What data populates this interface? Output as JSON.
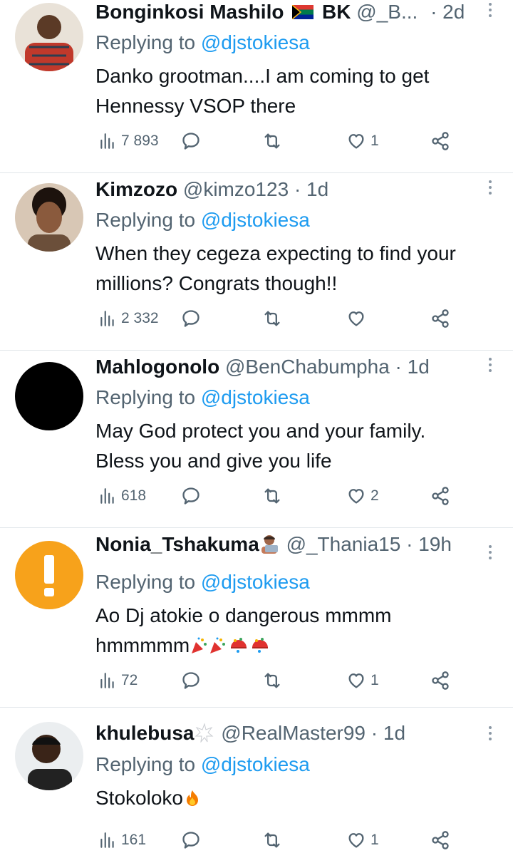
{
  "replies": [
    {
      "name": "Bonginkosi Mashilo",
      "flag_text": "BK",
      "handle": "@_B...",
      "dot": "·",
      "time": "2d",
      "replying_prefix": "Replying to",
      "replying_to": "@djstokiesa",
      "text": "Danko grootman....I am coming to get Hennessy VSOP there",
      "views": "7 893",
      "likes": "1",
      "avatar_color": "#c0392b"
    },
    {
      "name": "Kimzozo",
      "handle": "@kimzo123",
      "dot": "·",
      "time": "1d",
      "replying_prefix": "Replying to",
      "replying_to": "@djstokiesa",
      "text": "When they cegeza expecting to find your millions? Congrats though!!",
      "views": "2 332",
      "likes": "",
      "avatar_color": "#6b4f3a"
    },
    {
      "name": "Mahlogonolo",
      "handle": "@BenChabumpha",
      "dot": "·",
      "time": "1d",
      "replying_prefix": "Replying to",
      "replying_to": "@djstokiesa",
      "text": "May God protect you and your family. Bless you and give you life",
      "views": "618",
      "likes": "2",
      "avatar_color": "#000000"
    },
    {
      "name": "Nonia_Tshakuma",
      "handle": "@_Thania15",
      "dot": "·",
      "time": "19h",
      "replying_prefix": "Replying to",
      "replying_to": "@djstokiesa",
      "text": "Ao Dj atokie o dangerous mmmm hmmmmm",
      "views": "72",
      "likes": "1",
      "avatar_color": "#f7a21b"
    },
    {
      "name": "khulebusa",
      "handle": "@RealMaster99",
      "dot": "·",
      "time": "1d",
      "replying_prefix": "Replying to",
      "replying_to": "@djstokiesa",
      "text": "Stokoloko",
      "views": "161",
      "likes": "1",
      "avatar_color": "#3a3a3a"
    }
  ],
  "colors": {
    "link": "#1d9bf0",
    "secondary": "#536471",
    "divider": "#e1e6ea"
  }
}
